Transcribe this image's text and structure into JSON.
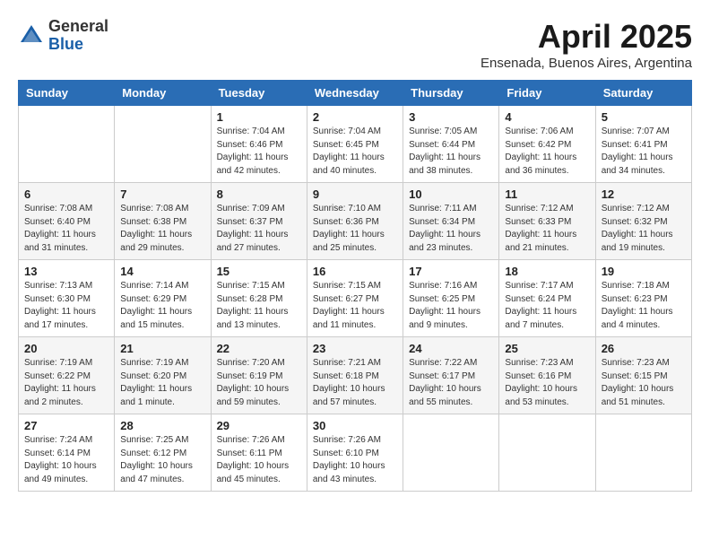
{
  "header": {
    "logo_general": "General",
    "logo_blue": "Blue",
    "month_title": "April 2025",
    "subtitle": "Ensenada, Buenos Aires, Argentina"
  },
  "weekdays": [
    "Sunday",
    "Monday",
    "Tuesday",
    "Wednesday",
    "Thursday",
    "Friday",
    "Saturday"
  ],
  "weeks": [
    [
      {
        "day": "",
        "info": ""
      },
      {
        "day": "",
        "info": ""
      },
      {
        "day": "1",
        "info": "Sunrise: 7:04 AM\nSunset: 6:46 PM\nDaylight: 11 hours and 42 minutes."
      },
      {
        "day": "2",
        "info": "Sunrise: 7:04 AM\nSunset: 6:45 PM\nDaylight: 11 hours and 40 minutes."
      },
      {
        "day": "3",
        "info": "Sunrise: 7:05 AM\nSunset: 6:44 PM\nDaylight: 11 hours and 38 minutes."
      },
      {
        "day": "4",
        "info": "Sunrise: 7:06 AM\nSunset: 6:42 PM\nDaylight: 11 hours and 36 minutes."
      },
      {
        "day": "5",
        "info": "Sunrise: 7:07 AM\nSunset: 6:41 PM\nDaylight: 11 hours and 34 minutes."
      }
    ],
    [
      {
        "day": "6",
        "info": "Sunrise: 7:08 AM\nSunset: 6:40 PM\nDaylight: 11 hours and 31 minutes."
      },
      {
        "day": "7",
        "info": "Sunrise: 7:08 AM\nSunset: 6:38 PM\nDaylight: 11 hours and 29 minutes."
      },
      {
        "day": "8",
        "info": "Sunrise: 7:09 AM\nSunset: 6:37 PM\nDaylight: 11 hours and 27 minutes."
      },
      {
        "day": "9",
        "info": "Sunrise: 7:10 AM\nSunset: 6:36 PM\nDaylight: 11 hours and 25 minutes."
      },
      {
        "day": "10",
        "info": "Sunrise: 7:11 AM\nSunset: 6:34 PM\nDaylight: 11 hours and 23 minutes."
      },
      {
        "day": "11",
        "info": "Sunrise: 7:12 AM\nSunset: 6:33 PM\nDaylight: 11 hours and 21 minutes."
      },
      {
        "day": "12",
        "info": "Sunrise: 7:12 AM\nSunset: 6:32 PM\nDaylight: 11 hours and 19 minutes."
      }
    ],
    [
      {
        "day": "13",
        "info": "Sunrise: 7:13 AM\nSunset: 6:30 PM\nDaylight: 11 hours and 17 minutes."
      },
      {
        "day": "14",
        "info": "Sunrise: 7:14 AM\nSunset: 6:29 PM\nDaylight: 11 hours and 15 minutes."
      },
      {
        "day": "15",
        "info": "Sunrise: 7:15 AM\nSunset: 6:28 PM\nDaylight: 11 hours and 13 minutes."
      },
      {
        "day": "16",
        "info": "Sunrise: 7:15 AM\nSunset: 6:27 PM\nDaylight: 11 hours and 11 minutes."
      },
      {
        "day": "17",
        "info": "Sunrise: 7:16 AM\nSunset: 6:25 PM\nDaylight: 11 hours and 9 minutes."
      },
      {
        "day": "18",
        "info": "Sunrise: 7:17 AM\nSunset: 6:24 PM\nDaylight: 11 hours and 7 minutes."
      },
      {
        "day": "19",
        "info": "Sunrise: 7:18 AM\nSunset: 6:23 PM\nDaylight: 11 hours and 4 minutes."
      }
    ],
    [
      {
        "day": "20",
        "info": "Sunrise: 7:19 AM\nSunset: 6:22 PM\nDaylight: 11 hours and 2 minutes."
      },
      {
        "day": "21",
        "info": "Sunrise: 7:19 AM\nSunset: 6:20 PM\nDaylight: 11 hours and 1 minute."
      },
      {
        "day": "22",
        "info": "Sunrise: 7:20 AM\nSunset: 6:19 PM\nDaylight: 10 hours and 59 minutes."
      },
      {
        "day": "23",
        "info": "Sunrise: 7:21 AM\nSunset: 6:18 PM\nDaylight: 10 hours and 57 minutes."
      },
      {
        "day": "24",
        "info": "Sunrise: 7:22 AM\nSunset: 6:17 PM\nDaylight: 10 hours and 55 minutes."
      },
      {
        "day": "25",
        "info": "Sunrise: 7:23 AM\nSunset: 6:16 PM\nDaylight: 10 hours and 53 minutes."
      },
      {
        "day": "26",
        "info": "Sunrise: 7:23 AM\nSunset: 6:15 PM\nDaylight: 10 hours and 51 minutes."
      }
    ],
    [
      {
        "day": "27",
        "info": "Sunrise: 7:24 AM\nSunset: 6:14 PM\nDaylight: 10 hours and 49 minutes."
      },
      {
        "day": "28",
        "info": "Sunrise: 7:25 AM\nSunset: 6:12 PM\nDaylight: 10 hours and 47 minutes."
      },
      {
        "day": "29",
        "info": "Sunrise: 7:26 AM\nSunset: 6:11 PM\nDaylight: 10 hours and 45 minutes."
      },
      {
        "day": "30",
        "info": "Sunrise: 7:26 AM\nSunset: 6:10 PM\nDaylight: 10 hours and 43 minutes."
      },
      {
        "day": "",
        "info": ""
      },
      {
        "day": "",
        "info": ""
      },
      {
        "day": "",
        "info": ""
      }
    ]
  ]
}
